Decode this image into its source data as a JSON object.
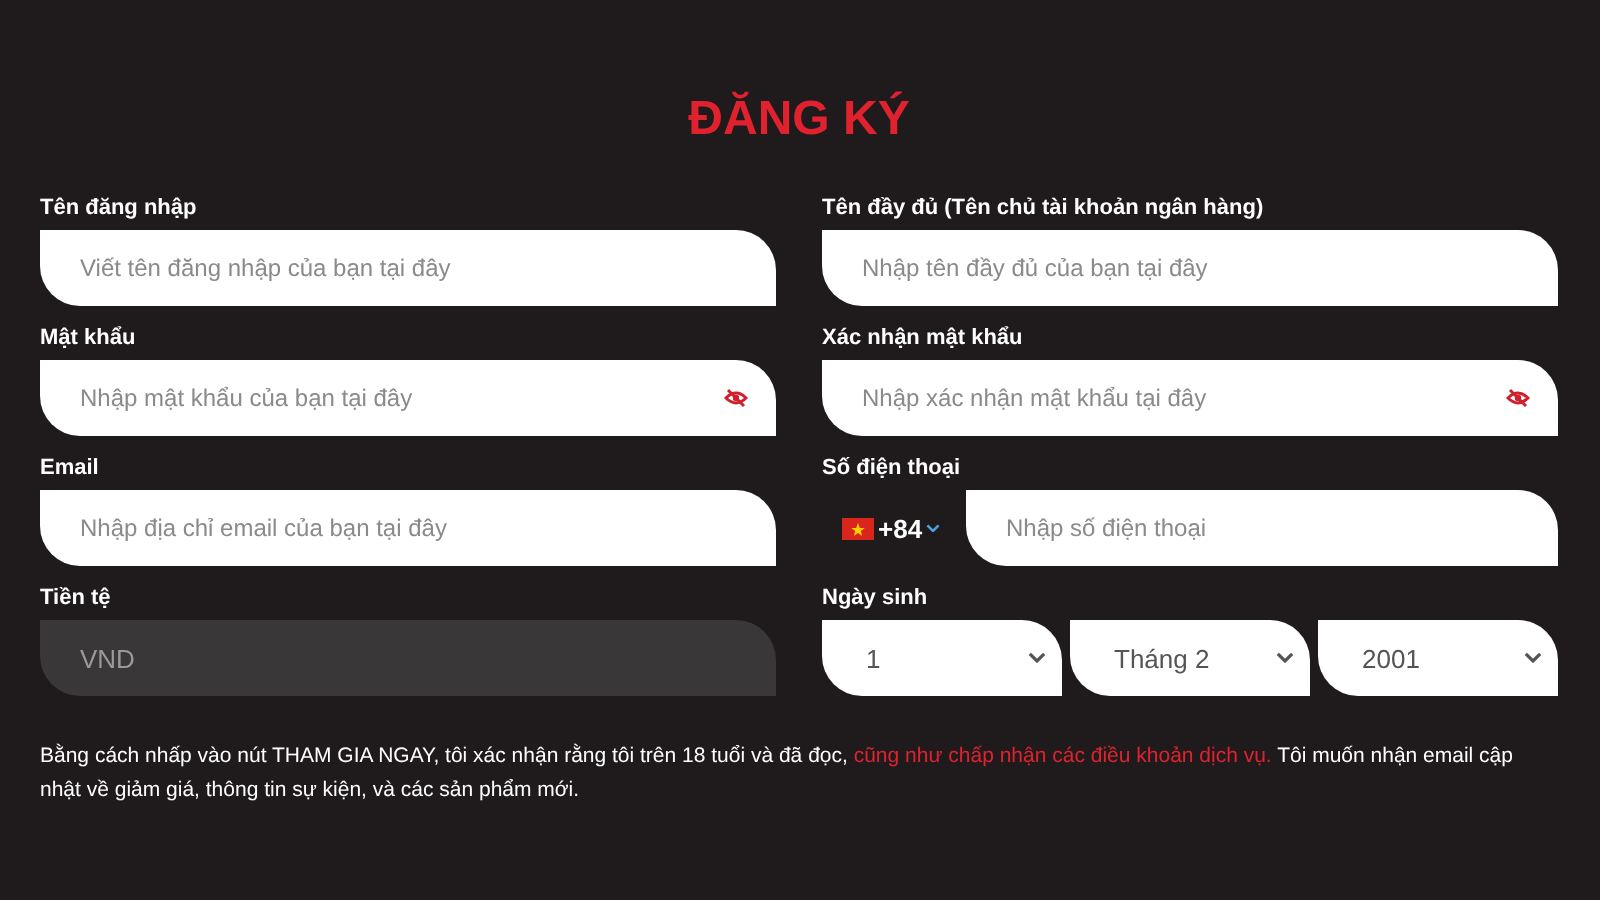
{
  "title": "ĐĂNG KÝ",
  "fields": [
    {
      "kind": "text",
      "label": "Tên đăng nhập",
      "placeholder": "Viết tên đăng nhập của bạn tại đây"
    },
    {
      "kind": "text",
      "label": "Tên đầy đủ (Tên chủ tài khoản ngân hàng)",
      "placeholder": "Nhập tên đầy đủ của bạn tại đây"
    },
    {
      "kind": "password",
      "label": "Mật khẩu",
      "placeholder": "Nhập mật khẩu của bạn tại đây"
    },
    {
      "kind": "password",
      "label": "Xác nhận mật khẩu",
      "placeholder": "Nhập xác nhận mật khẩu tại đây"
    },
    {
      "kind": "text",
      "label": "Email",
      "placeholder": "Nhập địa chỉ email của bạn tại đây"
    },
    {
      "kind": "phone",
      "label": "Số điện thoại",
      "code": "+84",
      "placeholder": "Nhập số điện thoại"
    },
    {
      "kind": "readonly",
      "label": "Tiền tệ",
      "value": "VND"
    },
    {
      "kind": "date",
      "label": "Ngày sinh",
      "selects": [
        "1",
        "Tháng 2",
        "2001"
      ]
    }
  ],
  "notice": {
    "before": "Bằng cách nhấp vào nút THAM GIA NGAY, tôi xác nhận rằng tôi trên 18 tuổi và đã đọc, ",
    "link": "cũng như chấp nhận các điều khoản dịch vụ.",
    "after": " Tôi muốn nhận email cập nhật về giảm giá, thông tin sự kiện, và các sản phẩm mới."
  }
}
